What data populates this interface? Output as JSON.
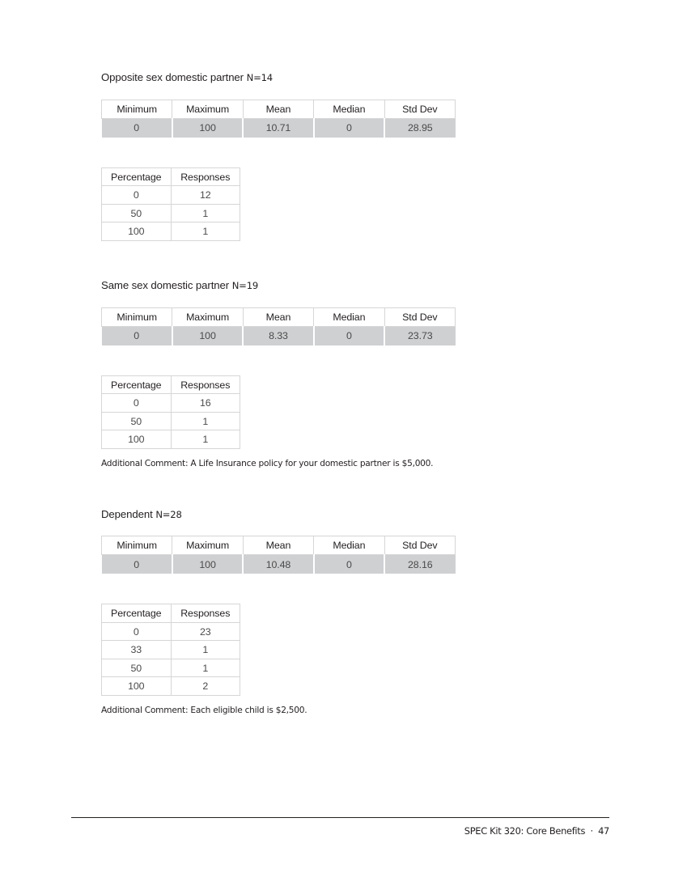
{
  "document": {
    "footer": {
      "title": "SPEC Kit 320: Core Benefits",
      "separator": "·",
      "page_number": "47"
    }
  },
  "stats_headers": [
    "Minimum",
    "Maximum",
    "Mean",
    "Median",
    "Std Dev"
  ],
  "pct_headers": [
    "Percentage",
    "Responses"
  ],
  "sections": [
    {
      "label": "Opposite sex domestic partner",
      "n": "N=14",
      "stats": [
        "0",
        "100",
        "10.71",
        "0",
        "28.95"
      ],
      "distribution": [
        {
          "percentage": "0",
          "responses": "12"
        },
        {
          "percentage": "50",
          "responses": "1"
        },
        {
          "percentage": "100",
          "responses": "1"
        }
      ],
      "comment": ""
    },
    {
      "label": "Same sex domestic partner",
      "n": "N=19",
      "stats": [
        "0",
        "100",
        "8.33",
        "0",
        "23.73"
      ],
      "distribution": [
        {
          "percentage": "0",
          "responses": "16"
        },
        {
          "percentage": "50",
          "responses": "1"
        },
        {
          "percentage": "100",
          "responses": "1"
        }
      ],
      "comment": "Additional Comment: A Life Insurance policy for your domestic partner is $5,000."
    },
    {
      "label": "Dependent",
      "n": "N=28",
      "stats": [
        "0",
        "100",
        "10.48",
        "0",
        "28.16"
      ],
      "distribution": [
        {
          "percentage": "0",
          "responses": "23"
        },
        {
          "percentage": "33",
          "responses": "1"
        },
        {
          "percentage": "50",
          "responses": "1"
        },
        {
          "percentage": "100",
          "responses": "2"
        }
      ],
      "comment": "Additional Comment: Each eligible child is $2,500."
    }
  ]
}
